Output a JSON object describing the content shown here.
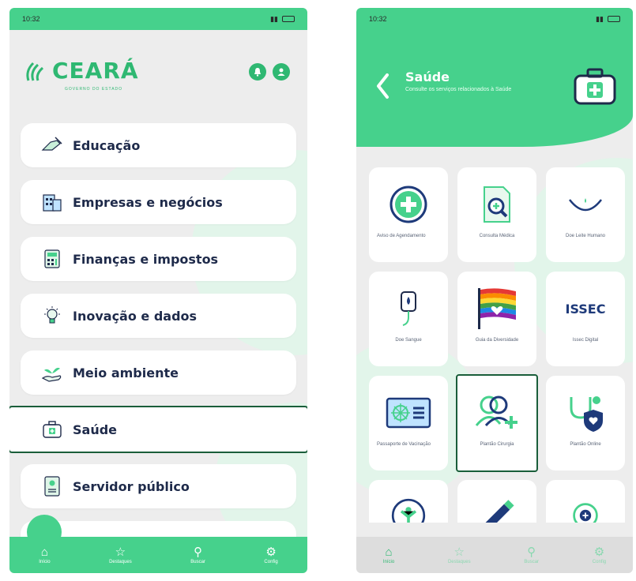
{
  "left": {
    "status": {
      "time": "10:32"
    },
    "logo": {
      "name": "CEARÁ",
      "subtitle": "GOVERNO DO ESTADO"
    },
    "menu": [
      {
        "label": "Educação",
        "icon": "writing-hand-icon"
      },
      {
        "label": "Empresas e negócios",
        "icon": "building-icon"
      },
      {
        "label": "Finanças e impostos",
        "icon": "calculator-icon"
      },
      {
        "label": "Inovação e dados",
        "icon": "lightbulb-icon"
      },
      {
        "label": "Meio ambiente",
        "icon": "plant-hand-icon"
      },
      {
        "label": "Saúde",
        "icon": "medical-kit-icon",
        "selected": true
      },
      {
        "label": "Servidor público",
        "icon": "id-badge-icon"
      }
    ],
    "nav": [
      {
        "label": "Início",
        "icon": "home-icon"
      },
      {
        "label": "Destaques",
        "icon": "star-icon"
      },
      {
        "label": "Buscar",
        "icon": "search-icon"
      },
      {
        "label": "Config",
        "icon": "gear-icon"
      }
    ]
  },
  "right": {
    "status": {
      "time": "10:32"
    },
    "header": {
      "title": "Saúde",
      "subtitle": "Consulte os serviços relacionados à Saúde"
    },
    "tiles": [
      {
        "label": "Aviso de Agendamento",
        "icon": "plus-circle-icon"
      },
      {
        "label": "Consulta Médica",
        "icon": "document-search-icon"
      },
      {
        "label": "Doe Leite Humano",
        "icon": "drop-cup-icon"
      },
      {
        "label": "Doe Sangue",
        "icon": "blood-bag-icon"
      },
      {
        "label": "Guia da Diversidade",
        "icon": "rainbow-flag-icon"
      },
      {
        "label": "Issec Digital",
        "icon": "issec-logo-icon",
        "logo_text": "ISSEC"
      },
      {
        "label": "Passaporte de Vacinação",
        "icon": "vaccine-card-icon"
      },
      {
        "label": "Plantão Cirurgia",
        "icon": "user-add-icon",
        "selected": true
      },
      {
        "label": "Plantão Online",
        "icon": "stethoscope-shield-icon"
      }
    ],
    "nav": [
      {
        "label": "Início",
        "icon": "home-icon"
      },
      {
        "label": "Destaques",
        "icon": "star-icon"
      },
      {
        "label": "Buscar",
        "icon": "search-icon"
      },
      {
        "label": "Config",
        "icon": "gear-icon"
      }
    ]
  },
  "colors": {
    "primary": "#46d18c",
    "primary_dark": "#2fb872",
    "navy": "#1e2a4a",
    "highlight": "#1a5e3a"
  }
}
